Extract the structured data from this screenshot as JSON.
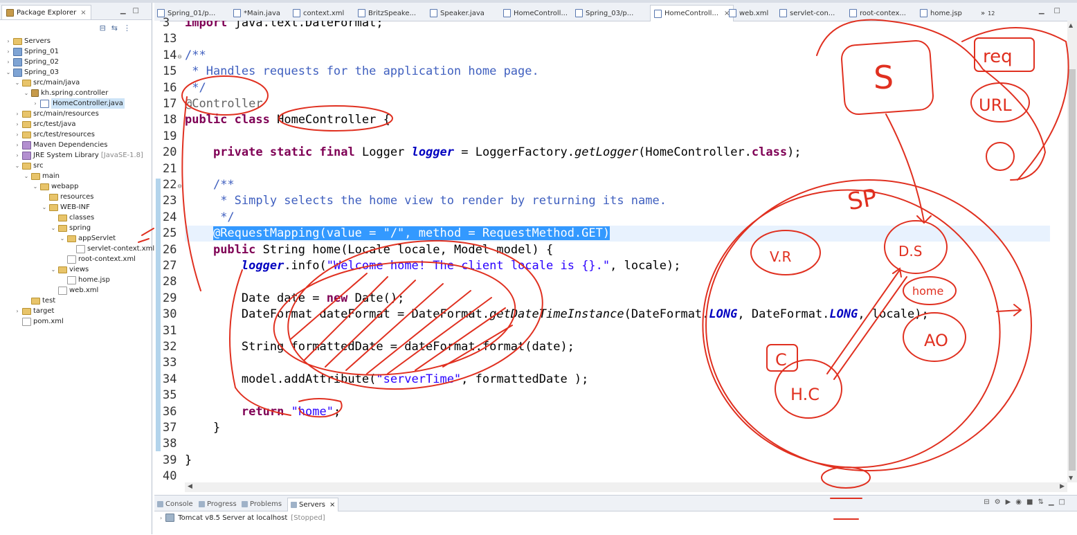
{
  "package_explorer": {
    "title": "Package Explorer",
    "close_glyph": "×",
    "tree": [
      {
        "label": "Servers",
        "icon": "folder-icon",
        "indent": 0,
        "arrow": "›"
      },
      {
        "label": "Spring_01",
        "icon": "project-icon",
        "indent": 0,
        "arrow": "›"
      },
      {
        "label": "Spring_02",
        "icon": "project-icon",
        "indent": 0,
        "arrow": "›"
      },
      {
        "label": "Spring_03",
        "icon": "project-icon",
        "indent": 0,
        "arrow": "⌄"
      },
      {
        "label": "src/main/java",
        "icon": "folder-icon",
        "indent": 1,
        "arrow": "⌄"
      },
      {
        "label": "kh.spring.controller",
        "icon": "package-icon",
        "indent": 2,
        "arrow": "⌄"
      },
      {
        "label": "HomeController.java",
        "icon": "java-file-icon",
        "indent": 3,
        "arrow": "›",
        "selected": true
      },
      {
        "label": "src/main/resources",
        "icon": "folder-icon",
        "indent": 1,
        "arrow": "›"
      },
      {
        "label": "src/test/java",
        "icon": "folder-icon",
        "indent": 1,
        "arrow": "›"
      },
      {
        "label": "src/test/resources",
        "icon": "folder-icon",
        "indent": 1,
        "arrow": "›"
      },
      {
        "label": "Maven Dependencies",
        "icon": "library-icon",
        "indent": 1,
        "arrow": "›"
      },
      {
        "label": "JRE System Library",
        "sub": "[JavaSE-1.8]",
        "icon": "library-icon",
        "indent": 1,
        "arrow": "›"
      },
      {
        "label": "src",
        "icon": "folder-icon",
        "indent": 1,
        "arrow": "⌄"
      },
      {
        "label": "main",
        "icon": "folder-icon",
        "indent": 2,
        "arrow": "⌄"
      },
      {
        "label": "webapp",
        "icon": "folder-icon",
        "indent": 3,
        "arrow": "⌄"
      },
      {
        "label": "resources",
        "icon": "folder-icon",
        "indent": 4,
        "arrow": ""
      },
      {
        "label": "WEB-INF",
        "icon": "folder-icon",
        "indent": 4,
        "arrow": "⌄"
      },
      {
        "label": "classes",
        "icon": "folder-icon",
        "indent": 5,
        "arrow": ""
      },
      {
        "label": "spring",
        "icon": "folder-icon",
        "indent": 5,
        "arrow": "⌄"
      },
      {
        "label": "appServlet",
        "icon": "folder-icon",
        "indent": 6,
        "arrow": "⌄"
      },
      {
        "label": "servlet-context.xml",
        "icon": "xml-file-icon",
        "indent": 7,
        "arrow": ""
      },
      {
        "label": "root-context.xml",
        "icon": "xml-file-icon",
        "indent": 6,
        "arrow": ""
      },
      {
        "label": "views",
        "icon": "folder-icon",
        "indent": 5,
        "arrow": "⌄"
      },
      {
        "label": "home.jsp",
        "icon": "xml-file-icon",
        "indent": 6,
        "arrow": ""
      },
      {
        "label": "web.xml",
        "icon": "xml-file-icon",
        "indent": 5,
        "arrow": ""
      },
      {
        "label": "test",
        "icon": "folder-icon",
        "indent": 2,
        "arrow": ""
      },
      {
        "label": "target",
        "icon": "folder-icon",
        "indent": 1,
        "arrow": "›"
      },
      {
        "label": "pom.xml",
        "icon": "xml-file-icon",
        "indent": 1,
        "arrow": ""
      }
    ]
  },
  "editor": {
    "tabs": [
      {
        "label": "Spring_01/p...",
        "active": false
      },
      {
        "label": "*Main.java",
        "active": false
      },
      {
        "label": "context.xml",
        "active": false
      },
      {
        "label": "BritzSpeake...",
        "active": false
      },
      {
        "label": "Speaker.java",
        "active": false
      },
      {
        "label": "HomeControll...",
        "active": false
      },
      {
        "label": "Spring_03/p...",
        "active": false
      },
      {
        "label": "HomeControll...",
        "active": true
      },
      {
        "label": "web.xml",
        "active": false
      },
      {
        "label": "servlet-con...",
        "active": false
      },
      {
        "label": "root-contex...",
        "active": false
      },
      {
        "label": "home.jsp",
        "active": false
      },
      {
        "label": "»",
        "active": false,
        "overflow": "12"
      }
    ],
    "close_glyph": "×",
    "lines": [
      {
        "n": "3",
        "fold": "",
        "segs": [
          [
            "kw",
            "import"
          ],
          [
            "",
            " java.text.DateFormat;"
          ]
        ]
      },
      {
        "n": "13",
        "fold": "",
        "segs": []
      },
      {
        "n": "14",
        "fold": "⊖",
        "segs": [
          [
            "cm",
            "/**"
          ]
        ]
      },
      {
        "n": "15",
        "fold": "",
        "segs": [
          [
            "cm",
            " * Handles requests for the application home page."
          ]
        ]
      },
      {
        "n": "16",
        "fold": "",
        "segs": [
          [
            "cm",
            " */"
          ]
        ]
      },
      {
        "n": "17",
        "fold": "",
        "segs": [
          [
            "an",
            "@Controller"
          ]
        ]
      },
      {
        "n": "18",
        "fold": "",
        "segs": [
          [
            "kw",
            "public"
          ],
          [
            "",
            " "
          ],
          [
            "kw",
            "class"
          ],
          [
            "",
            " HomeController {"
          ]
        ]
      },
      {
        "n": "19",
        "fold": "",
        "segs": []
      },
      {
        "n": "20",
        "fold": "",
        "segs": [
          [
            "",
            "    "
          ],
          [
            "kw",
            "private"
          ],
          [
            "",
            " "
          ],
          [
            "kw",
            "static"
          ],
          [
            "",
            " "
          ],
          [
            "kw",
            "final"
          ],
          [
            "",
            " Logger "
          ],
          [
            "fld",
            "logger"
          ],
          [
            "",
            " = LoggerFactory."
          ],
          [
            "it",
            "getLogger"
          ],
          [
            "",
            "(HomeController."
          ],
          [
            "kw",
            "class"
          ],
          [
            "",
            ");"
          ]
        ]
      },
      {
        "n": "21",
        "fold": "",
        "segs": []
      },
      {
        "n": "22",
        "fold": "⊖",
        "segs": [
          [
            "",
            "    "
          ],
          [
            "cm",
            "/**"
          ]
        ]
      },
      {
        "n": "23",
        "fold": "",
        "segs": [
          [
            "",
            "    "
          ],
          [
            "cm",
            " * Simply selects the home view to render by returning its name."
          ]
        ]
      },
      {
        "n": "24",
        "fold": "",
        "segs": [
          [
            "",
            "    "
          ],
          [
            "cm",
            " */"
          ]
        ]
      },
      {
        "n": "25",
        "fold": "",
        "selected": true,
        "segs": [
          [
            "",
            "    "
          ],
          [
            "sel",
            "@RequestMapping(value = \"/\", method = RequestMethod.GET)"
          ]
        ]
      },
      {
        "n": "26",
        "fold": "",
        "segs": [
          [
            "",
            "    "
          ],
          [
            "kw",
            "public"
          ],
          [
            "",
            " String home(Locale locale, Model model) {"
          ]
        ]
      },
      {
        "n": "27",
        "fold": "",
        "segs": [
          [
            "",
            "        "
          ],
          [
            "fld",
            "logger"
          ],
          [
            "",
            ".info("
          ],
          [
            "str",
            "\"Welcome home! The client locale is {}.\""
          ],
          [
            "",
            ", locale);"
          ]
        ]
      },
      {
        "n": "28",
        "fold": "",
        "segs": []
      },
      {
        "n": "29",
        "fold": "",
        "segs": [
          [
            "",
            "        Date date = "
          ],
          [
            "kw",
            "new"
          ],
          [
            "",
            " Date();"
          ]
        ]
      },
      {
        "n": "30",
        "fold": "",
        "segs": [
          [
            "",
            "        DateFormat dateFormat = DateFormat."
          ],
          [
            "it",
            "getDateTimeInstance"
          ],
          [
            "",
            "(DateFormat."
          ],
          [
            "cst",
            "LONG"
          ],
          [
            "",
            ", DateFormat."
          ],
          [
            "cst",
            "LONG"
          ],
          [
            "",
            ", locale);"
          ]
        ]
      },
      {
        "n": "31",
        "fold": "",
        "segs": []
      },
      {
        "n": "32",
        "fold": "",
        "segs": [
          [
            "",
            "        String formattedDate = dateFormat.format(date);"
          ]
        ]
      },
      {
        "n": "33",
        "fold": "",
        "segs": []
      },
      {
        "n": "34",
        "fold": "",
        "segs": [
          [
            "",
            "        model.addAttribute("
          ],
          [
            "str",
            "\"serverTime\""
          ],
          [
            "",
            ", formattedDate );"
          ]
        ]
      },
      {
        "n": "35",
        "fold": "",
        "segs": []
      },
      {
        "n": "36",
        "fold": "",
        "segs": [
          [
            "",
            "        "
          ],
          [
            "kw",
            "return"
          ],
          [
            "",
            " "
          ],
          [
            "str",
            "\"home\""
          ],
          [
            "",
            ";"
          ]
        ]
      },
      {
        "n": "37",
        "fold": "",
        "segs": [
          [
            "",
            "    }"
          ]
        ]
      },
      {
        "n": "38",
        "fold": "",
        "segs": []
      },
      {
        "n": "39",
        "fold": "",
        "segs": [
          [
            "",
            "}"
          ]
        ]
      },
      {
        "n": "40",
        "fold": "",
        "segs": []
      }
    ]
  },
  "bottom_panel": {
    "tabs": [
      {
        "label": "Console",
        "active": false
      },
      {
        "label": "Progress",
        "active": false
      },
      {
        "label": "Problems",
        "active": false
      },
      {
        "label": "Servers",
        "active": true
      }
    ],
    "close_glyph": "×",
    "server": {
      "name": "Tomcat v8.5 Server at localhost",
      "status": "[Stopped]"
    }
  },
  "annotations": {
    "color": "#e03020",
    "handwriting": [
      "S",
      "req",
      "URL",
      "SP",
      "V.R",
      "D.S",
      "home",
      "AO",
      "C",
      "H.C"
    ]
  },
  "colors": {
    "keyword": "#7f0055",
    "comment": "#3f5fbf",
    "string": "#2a00ff",
    "selection": "#3399ff"
  }
}
